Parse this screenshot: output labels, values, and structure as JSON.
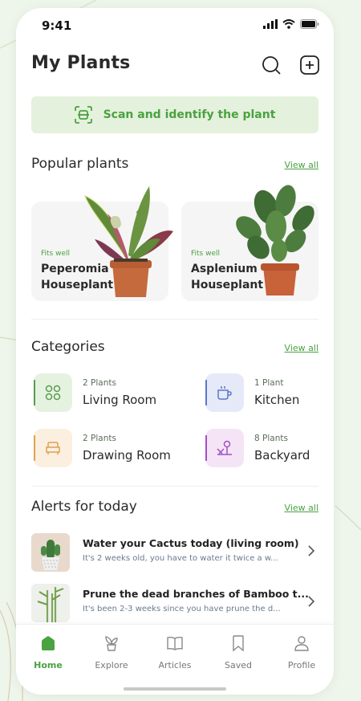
{
  "status": {
    "time": "9:41"
  },
  "header": {
    "title": "My Plants"
  },
  "scan": {
    "label": "Scan and identify the plant"
  },
  "popular": {
    "title": "Popular plants",
    "view_all": "View all",
    "cards": [
      {
        "tag": "Fits well",
        "name_line1": "Peperomia",
        "name_line2": "Houseplant"
      },
      {
        "tag": "Fits well",
        "name_line1": "Asplenium",
        "name_line2": "Houseplant"
      }
    ]
  },
  "categories": {
    "title": "Categories",
    "view_all": "View all",
    "items": [
      {
        "count": "2 Plants",
        "name": "Living Room",
        "icon": "grid-icon",
        "color": "#5a9a52",
        "bg": "#e6f2e0"
      },
      {
        "count": "1 Plant",
        "name": "Kitchen",
        "icon": "mug-icon",
        "color": "#5a78c8",
        "bg": "#e6eaf8"
      },
      {
        "count": "2 Plants",
        "name": "Drawing Room",
        "icon": "armchair-icon",
        "color": "#e0a050",
        "bg": "#fbefdf"
      },
      {
        "count": "8 Plants",
        "name": "Backyard",
        "icon": "tree-icon",
        "color": "#a050c8",
        "bg": "#f4e4f6"
      }
    ]
  },
  "alerts": {
    "title": "Alerts for today",
    "view_all": "View all",
    "items": [
      {
        "title": "Water your Cactus today (living room)",
        "desc": "It's 2 weeks old, you have to water it twice a w..."
      },
      {
        "title": "Prune the dead branches of Bamboo t...",
        "desc": "It's been 2-3 weeks since you have prune the d..."
      }
    ]
  },
  "nav": {
    "items": [
      {
        "label": "Home",
        "icon": "home-icon",
        "active": true
      },
      {
        "label": "Explore",
        "icon": "plant-icon"
      },
      {
        "label": "Articles",
        "icon": "book-icon"
      },
      {
        "label": "Saved",
        "icon": "bookmark-icon"
      },
      {
        "label": "Profile",
        "icon": "user-icon"
      }
    ]
  },
  "colors": {
    "accent": "#4aa241",
    "scan_bg": "#e4f1dc",
    "text": "#2a2a2a"
  }
}
